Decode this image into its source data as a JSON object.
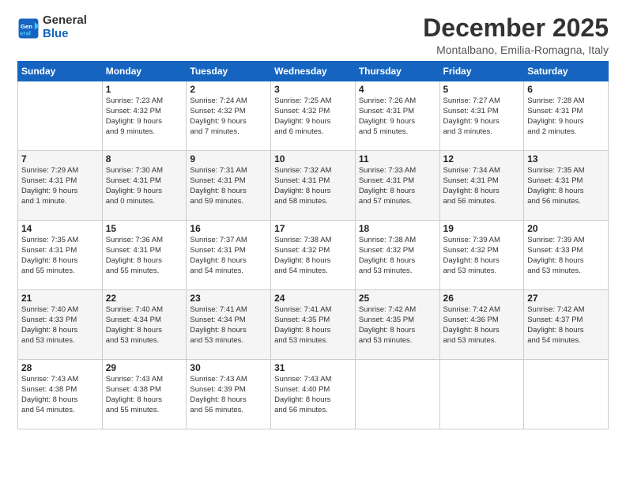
{
  "logo": {
    "line1": "General",
    "line2": "Blue"
  },
  "title": "December 2025",
  "location": "Montalbano, Emilia-Romagna, Italy",
  "header_days": [
    "Sunday",
    "Monday",
    "Tuesday",
    "Wednesday",
    "Thursday",
    "Friday",
    "Saturday"
  ],
  "weeks": [
    [
      {
        "day": "",
        "info": ""
      },
      {
        "day": "1",
        "info": "Sunrise: 7:23 AM\nSunset: 4:32 PM\nDaylight: 9 hours\nand 9 minutes."
      },
      {
        "day": "2",
        "info": "Sunrise: 7:24 AM\nSunset: 4:32 PM\nDaylight: 9 hours\nand 7 minutes."
      },
      {
        "day": "3",
        "info": "Sunrise: 7:25 AM\nSunset: 4:32 PM\nDaylight: 9 hours\nand 6 minutes."
      },
      {
        "day": "4",
        "info": "Sunrise: 7:26 AM\nSunset: 4:31 PM\nDaylight: 9 hours\nand 5 minutes."
      },
      {
        "day": "5",
        "info": "Sunrise: 7:27 AM\nSunset: 4:31 PM\nDaylight: 9 hours\nand 3 minutes."
      },
      {
        "day": "6",
        "info": "Sunrise: 7:28 AM\nSunset: 4:31 PM\nDaylight: 9 hours\nand 2 minutes."
      }
    ],
    [
      {
        "day": "7",
        "info": "Sunrise: 7:29 AM\nSunset: 4:31 PM\nDaylight: 9 hours\nand 1 minute."
      },
      {
        "day": "8",
        "info": "Sunrise: 7:30 AM\nSunset: 4:31 PM\nDaylight: 9 hours\nand 0 minutes."
      },
      {
        "day": "9",
        "info": "Sunrise: 7:31 AM\nSunset: 4:31 PM\nDaylight: 8 hours\nand 59 minutes."
      },
      {
        "day": "10",
        "info": "Sunrise: 7:32 AM\nSunset: 4:31 PM\nDaylight: 8 hours\nand 58 minutes."
      },
      {
        "day": "11",
        "info": "Sunrise: 7:33 AM\nSunset: 4:31 PM\nDaylight: 8 hours\nand 57 minutes."
      },
      {
        "day": "12",
        "info": "Sunrise: 7:34 AM\nSunset: 4:31 PM\nDaylight: 8 hours\nand 56 minutes."
      },
      {
        "day": "13",
        "info": "Sunrise: 7:35 AM\nSunset: 4:31 PM\nDaylight: 8 hours\nand 56 minutes."
      }
    ],
    [
      {
        "day": "14",
        "info": "Sunrise: 7:35 AM\nSunset: 4:31 PM\nDaylight: 8 hours\nand 55 minutes."
      },
      {
        "day": "15",
        "info": "Sunrise: 7:36 AM\nSunset: 4:31 PM\nDaylight: 8 hours\nand 55 minutes."
      },
      {
        "day": "16",
        "info": "Sunrise: 7:37 AM\nSunset: 4:31 PM\nDaylight: 8 hours\nand 54 minutes."
      },
      {
        "day": "17",
        "info": "Sunrise: 7:38 AM\nSunset: 4:32 PM\nDaylight: 8 hours\nand 54 minutes."
      },
      {
        "day": "18",
        "info": "Sunrise: 7:38 AM\nSunset: 4:32 PM\nDaylight: 8 hours\nand 53 minutes."
      },
      {
        "day": "19",
        "info": "Sunrise: 7:39 AM\nSunset: 4:32 PM\nDaylight: 8 hours\nand 53 minutes."
      },
      {
        "day": "20",
        "info": "Sunrise: 7:39 AM\nSunset: 4:33 PM\nDaylight: 8 hours\nand 53 minutes."
      }
    ],
    [
      {
        "day": "21",
        "info": "Sunrise: 7:40 AM\nSunset: 4:33 PM\nDaylight: 8 hours\nand 53 minutes."
      },
      {
        "day": "22",
        "info": "Sunrise: 7:40 AM\nSunset: 4:34 PM\nDaylight: 8 hours\nand 53 minutes."
      },
      {
        "day": "23",
        "info": "Sunrise: 7:41 AM\nSunset: 4:34 PM\nDaylight: 8 hours\nand 53 minutes."
      },
      {
        "day": "24",
        "info": "Sunrise: 7:41 AM\nSunset: 4:35 PM\nDaylight: 8 hours\nand 53 minutes."
      },
      {
        "day": "25",
        "info": "Sunrise: 7:42 AM\nSunset: 4:35 PM\nDaylight: 8 hours\nand 53 minutes."
      },
      {
        "day": "26",
        "info": "Sunrise: 7:42 AM\nSunset: 4:36 PM\nDaylight: 8 hours\nand 53 minutes."
      },
      {
        "day": "27",
        "info": "Sunrise: 7:42 AM\nSunset: 4:37 PM\nDaylight: 8 hours\nand 54 minutes."
      }
    ],
    [
      {
        "day": "28",
        "info": "Sunrise: 7:43 AM\nSunset: 4:38 PM\nDaylight: 8 hours\nand 54 minutes."
      },
      {
        "day": "29",
        "info": "Sunrise: 7:43 AM\nSunset: 4:38 PM\nDaylight: 8 hours\nand 55 minutes."
      },
      {
        "day": "30",
        "info": "Sunrise: 7:43 AM\nSunset: 4:39 PM\nDaylight: 8 hours\nand 56 minutes."
      },
      {
        "day": "31",
        "info": "Sunrise: 7:43 AM\nSunset: 4:40 PM\nDaylight: 8 hours\nand 56 minutes."
      },
      {
        "day": "",
        "info": ""
      },
      {
        "day": "",
        "info": ""
      },
      {
        "day": "",
        "info": ""
      }
    ]
  ]
}
